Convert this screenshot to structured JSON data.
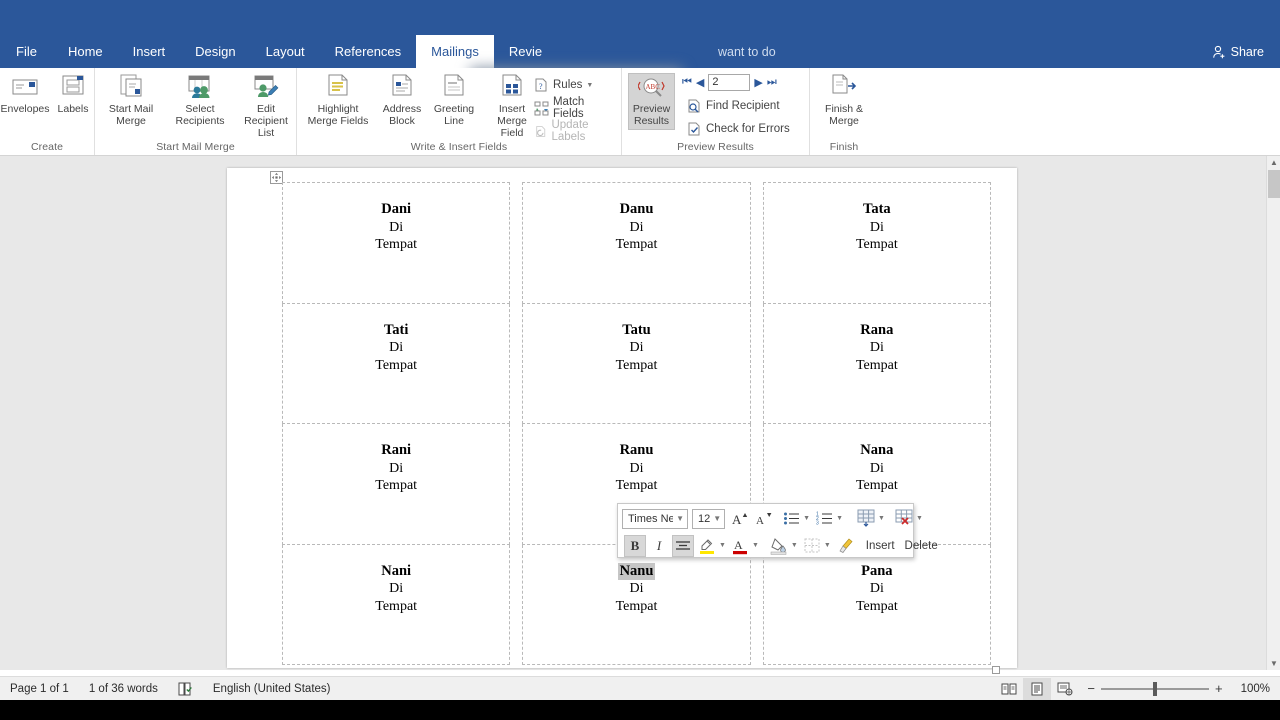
{
  "window": {
    "tabs": [
      {
        "label": "File",
        "active": false
      },
      {
        "label": "Home",
        "active": false
      },
      {
        "label": "Insert",
        "active": false
      },
      {
        "label": "Design",
        "active": false
      },
      {
        "label": "Layout",
        "active": false
      },
      {
        "label": "References",
        "active": false
      },
      {
        "label": "Mailings",
        "active": true
      },
      {
        "label": "Revie",
        "active": false
      }
    ],
    "tell_me": "want to do",
    "share_label": "Share",
    "share_icon": "person-add-icon",
    "accent_color": "#2b579a"
  },
  "ribbon": {
    "groups": [
      {
        "title": "Create",
        "buttons": [
          {
            "label": "Envelopes",
            "icon": "envelope-icon"
          },
          {
            "label": "Labels",
            "icon": "labels-icon"
          }
        ]
      },
      {
        "title": "Start Mail Merge",
        "buttons": [
          {
            "label": "Start Mail\nMerge",
            "icon": "start-mail-merge-icon",
            "dropdown": true
          },
          {
            "label": "Select\nRecipients",
            "icon": "select-recipients-icon",
            "dropdown": true
          },
          {
            "label": "Edit\nRecipient List",
            "icon": "edit-recipient-list-icon",
            "dropdown": false
          }
        ]
      },
      {
        "title": "Write & Insert Fields",
        "buttons": [
          {
            "label": "Highlight\nMerge Fields",
            "icon": "highlight-merge-fields-icon"
          },
          {
            "label": "Address\nBlock",
            "icon": "address-block-icon"
          },
          {
            "label": "Greeting\nLine",
            "icon": "greeting-line-icon"
          },
          {
            "label": "Insert Merge\nField",
            "icon": "insert-merge-field-icon",
            "dropdown": true
          }
        ],
        "small_buttons": [
          {
            "label": "Rules",
            "icon": "rules-icon",
            "dropdown": true,
            "enabled": true
          },
          {
            "label": "Match Fields",
            "icon": "match-fields-icon",
            "dropdown": false,
            "enabled": true
          },
          {
            "label": "Update Labels",
            "icon": "update-labels-icon",
            "dropdown": false,
            "enabled": false
          }
        ]
      },
      {
        "title": "Preview Results",
        "preview_button": {
          "label": "Preview\nResults",
          "icon": "preview-results-icon",
          "active": true
        },
        "record_value": "2",
        "nav": {
          "first": "first-record-icon",
          "prev": "previous-record-icon",
          "next": "next-record-icon",
          "last": "last-record-icon"
        },
        "small_buttons": [
          {
            "label": "Find Recipient",
            "icon": "find-recipient-icon"
          },
          {
            "label": "Check for Errors",
            "icon": "check-for-errors-icon"
          }
        ]
      },
      {
        "title": "Finish",
        "buttons": [
          {
            "label": "Finish &\nMerge",
            "icon": "finish-and-merge-icon",
            "dropdown": true
          }
        ]
      }
    ]
  },
  "document": {
    "label_lines": {
      "line2": "Di",
      "line3": "Tempat"
    },
    "selected_name": "Nanu",
    "rows": [
      [
        "Dani",
        "Danu",
        "Tata"
      ],
      [
        "Tati",
        "Tatu",
        "Rana"
      ],
      [
        "Rani",
        "Ranu",
        "Nana"
      ],
      [
        "Nani",
        "Nanu",
        "Pana"
      ]
    ]
  },
  "mini_toolbar": {
    "font_name": "Times Ne",
    "font_size": "12",
    "grow_font_icon": "grow-font-icon",
    "shrink_font_icon": "shrink-font-icon",
    "bullets_icon": "bullets-icon",
    "numbering_icon": "numbering-icon",
    "insert_label": "Insert",
    "delete_label": "Delete",
    "insert_icon": "insert-table-icon",
    "delete_icon": "delete-table-icon",
    "bold_label": "B",
    "italic_label": "I",
    "bold_active": true,
    "align_icon": "align-center-icon",
    "highlight_icon": "text-highlight-icon",
    "font_color_icon": "font-color-icon",
    "shading_icon": "shading-icon",
    "borders_icon": "borders-icon",
    "format_painter_icon": "format-painter-icon",
    "highlight_color": "#ffe700",
    "font_color": "#cc0000"
  },
  "status_bar": {
    "page_info": "Page 1 of 1",
    "word_count": "1 of 36 words",
    "proofing_icon": "proofing-errors-icon",
    "language": "English (United States)",
    "views": [
      {
        "icon": "read-mode-icon",
        "active": false
      },
      {
        "icon": "print-layout-icon",
        "active": true
      },
      {
        "icon": "web-layout-icon",
        "active": false
      }
    ],
    "zoom_out": "−",
    "zoom_in": "+",
    "zoom_level": "100%"
  }
}
